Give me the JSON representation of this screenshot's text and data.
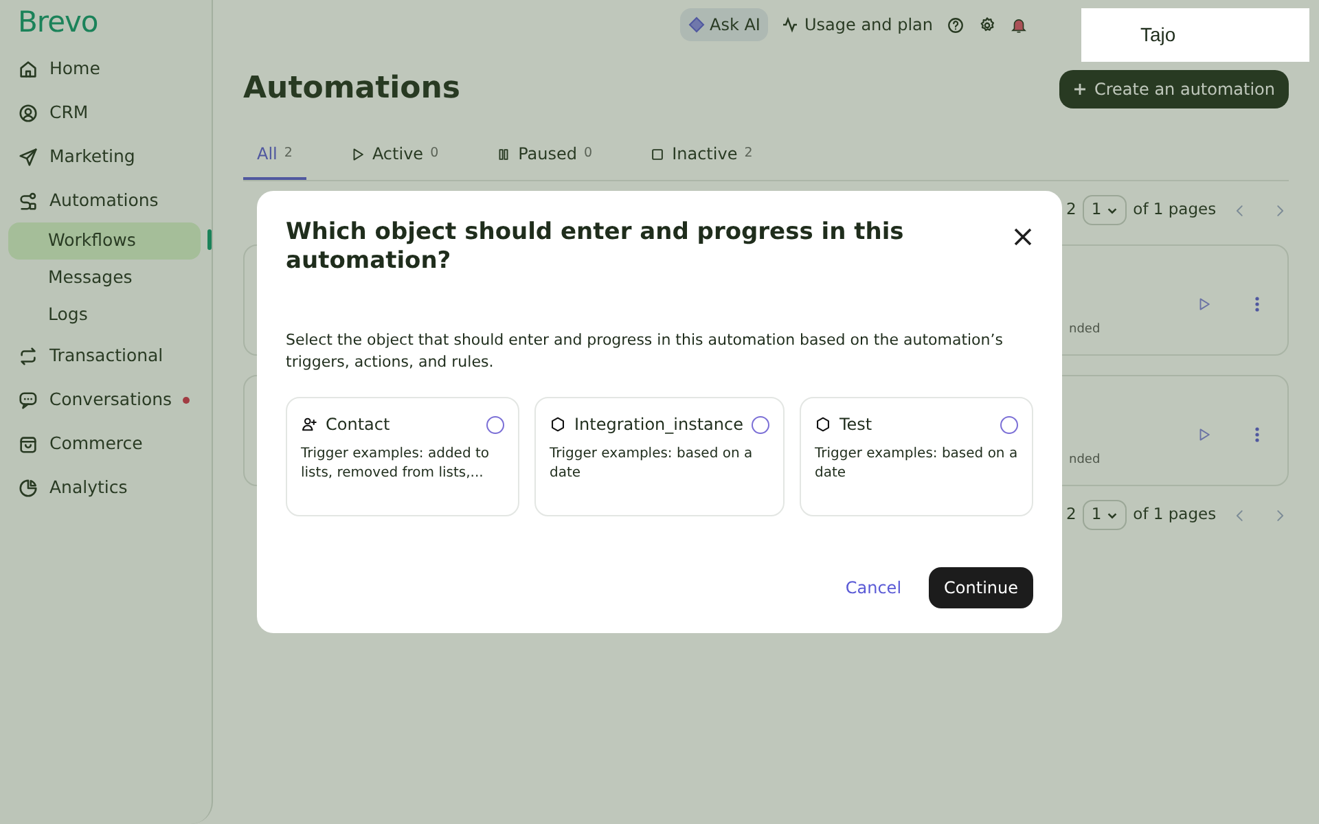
{
  "logo": "Brevo",
  "sidebar": {
    "items": [
      {
        "label": "Home",
        "kind": "section",
        "selected": false,
        "notification": false
      },
      {
        "label": "CRM",
        "kind": "section",
        "selected": false,
        "notification": false
      },
      {
        "label": "Marketing",
        "kind": "section",
        "selected": false,
        "notification": false
      },
      {
        "label": "Automations",
        "kind": "section",
        "selected": false,
        "notification": false
      },
      {
        "label": "Workflows",
        "kind": "subitem",
        "selected": true,
        "notification": false
      },
      {
        "label": "Messages",
        "kind": "subitem",
        "selected": false,
        "notification": false
      },
      {
        "label": "Logs",
        "kind": "subitem",
        "selected": false,
        "notification": false
      },
      {
        "label": "Transactional",
        "kind": "section",
        "selected": false,
        "notification": false
      },
      {
        "label": "Conversations",
        "kind": "section",
        "selected": false,
        "notification": true
      },
      {
        "label": "Commerce",
        "kind": "section",
        "selected": false,
        "notification": false
      },
      {
        "label": "Analytics",
        "kind": "section",
        "selected": false,
        "notification": false
      }
    ]
  },
  "topbar": {
    "ask_ai": "Ask AI",
    "usage": "Usage and plan",
    "user": "Tajo"
  },
  "page": {
    "title": "Automations",
    "create_button": "Create an automation",
    "tabs": [
      {
        "label": "All",
        "count": "2",
        "selected": true
      },
      {
        "label": "Active",
        "count": "0",
        "selected": false
      },
      {
        "label": "Paused",
        "count": "0",
        "selected": false
      },
      {
        "label": "Inactive",
        "count": "2",
        "selected": false
      }
    ],
    "pagination_top": {
      "count": "2",
      "page": "1",
      "of": "of 1 pages"
    },
    "rows": [
      {
        "status": "nded"
      },
      {
        "status": "nded"
      }
    ],
    "pagination_bottom": {
      "count": "2",
      "page": "1",
      "of": "of 1 pages"
    }
  },
  "modal": {
    "title": "Which object should enter and progress in this automation?",
    "description": "Select the object that should enter and progress in this automation based on the automation’s triggers, actions, and rules.",
    "options": [
      {
        "name": "Contact",
        "kind": "contact",
        "text": "Trigger examples: added to lists, removed from lists,...",
        "selected": false
      },
      {
        "name": "Integration_instance",
        "kind": "object",
        "text": "Trigger examples: based on a date",
        "selected": false
      },
      {
        "name": "Test",
        "kind": "object",
        "text": "Trigger examples: based on a date",
        "selected": false
      }
    ],
    "cancel": "Cancel",
    "continue": "Continue"
  }
}
